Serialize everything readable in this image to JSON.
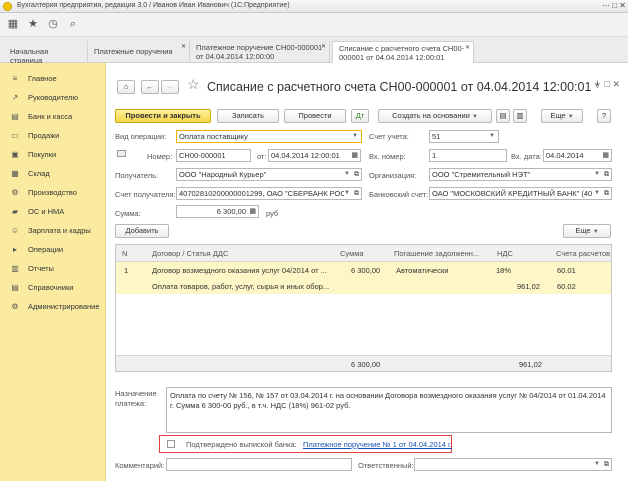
{
  "window": {
    "title": "Бухгалтерия предприятия, редакция 3.0 / Иванов Иван Иванович (1С:Предприятие)",
    "controls": "⋯  □  ✕"
  },
  "tabs": [
    {
      "label": "Начальная страница"
    },
    {
      "label": "Платежные поручения"
    },
    {
      "label": "Платежное поручение СН00-000001 от 04.04.2014 12:00:00"
    },
    {
      "label": "Списание с расчетного счета СН00-000001 от 04.04.2014 12:00:01"
    }
  ],
  "sidebar": {
    "items": [
      {
        "label": "Главное",
        "icon": "≡"
      },
      {
        "label": "Руководителю",
        "icon": "↗"
      },
      {
        "label": "Банк и касса",
        "icon": "▤"
      },
      {
        "label": "Продажи",
        "icon": "▭"
      },
      {
        "label": "Покупки",
        "icon": "▣"
      },
      {
        "label": "Склад",
        "icon": "▦"
      },
      {
        "label": "Производство",
        "icon": "⚙"
      },
      {
        "label": "ОС и НМА",
        "icon": "▰"
      },
      {
        "label": "Зарплата и кадры",
        "icon": "☺"
      },
      {
        "label": "Операции",
        "icon": "▸"
      },
      {
        "label": "Отчеты",
        "icon": "▥"
      },
      {
        "label": "Справочники",
        "icon": "▤"
      },
      {
        "label": "Администрирование",
        "icon": "⚙"
      }
    ]
  },
  "doc": {
    "title": "Списание с расчетного счета СН00-000001 от 04.04.2014 12:00:01 *",
    "buttons": {
      "post_close": "Провести и закрыть",
      "save": "Записать",
      "post": "Провести",
      "create_based": "Создать на основании",
      "more": "Еще",
      "help": "?"
    },
    "fields": {
      "operation_label": "Вид операции:",
      "operation_value": "Оплата поставщику",
      "account_label": "Счет учета:",
      "account_value": "51",
      "number_label": "Номер:",
      "number_value": "СН00-000001",
      "from_label": "от:",
      "from_value": "04.04.2014 12:00:01",
      "in_number_label": "Вх. номер:",
      "in_number_value": "1",
      "in_date_label": "Вх. дата:",
      "in_date_value": "04.04.2014",
      "recipient_label": "Получатель:",
      "recipient_value": "ООО \"Народный Курьер\"",
      "org_label": "Организация:",
      "org_value": "ООО \"Стремительный НЭТ\"",
      "recipient_acc_label": "Счет получателя:",
      "recipient_acc_value": "40702810200000001299, ОАО \"СБЕРБАНК РОС",
      "bank_acc_label": "Банковский счет:",
      "bank_acc_value": "ОАО \"МОСКОВСКИЙ КРЕДИТНЫЙ БАНК\" (40",
      "sum_label": "Сумма:",
      "sum_value": "6 300,00",
      "sum_unit": "руб"
    },
    "table_toolbar": {
      "add": "Добавить",
      "more": "Еще"
    },
    "table": {
      "headers": [
        "N",
        "Договор / Статья ДДС",
        "Сумма",
        "Погашение задолженн...",
        "НДС",
        "Счета расчетов"
      ],
      "row1": {
        "n": "1",
        "contract": "Договор возмездного оказания услуг 04/2014 от ...",
        "sum": "6 300,00",
        "repay": "Автоматически",
        "vat_rate": "18%",
        "accounts": "60.01"
      },
      "row2": {
        "contract": "Оплата товаров, работ, услуг, сырья и иных обор...",
        "vat_sum": "961,02",
        "accounts": "60.02"
      },
      "footer": {
        "sum": "6 300,00",
        "vat": "961,02"
      }
    },
    "purpose": {
      "label": "Назначение платежа:",
      "text": "Оплата по счету № 156, № 157 от 03.04.2014 г. на основании Договора возмездного оказания услуг № 04/2014 от 01.04.2014 г. Сумма 6 300-00 руб., в т.ч. НДС (18%) 961-02 руб."
    },
    "bank_confirm": {
      "label": "Подтверждено выпиской банка:",
      "link": "Платежное поручение № 1 от 04.04.2014 г."
    },
    "comment_label": "Комментарий:",
    "responsible_label": "Ответственный:"
  }
}
